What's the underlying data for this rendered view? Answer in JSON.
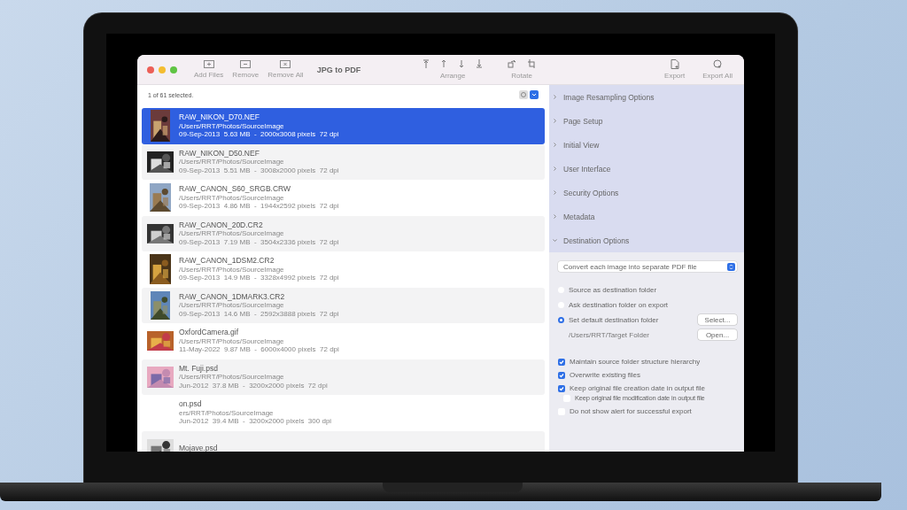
{
  "window": {
    "title": "JPG to PDF"
  },
  "toolbar": {
    "file_buttons": [
      {
        "kind": "add",
        "label": "Add Files"
      },
      {
        "kind": "remove",
        "label": "Remove"
      },
      {
        "kind": "remove_all",
        "label": "Remove All"
      }
    ],
    "arrange": {
      "label": "Arrange",
      "buttons": [
        {
          "kind": "top"
        },
        {
          "kind": "up"
        },
        {
          "kind": "down"
        },
        {
          "kind": "bottom"
        }
      ]
    },
    "rotate": {
      "label": "Rotate",
      "buttons": [
        {
          "kind": "left"
        },
        {
          "kind": "right"
        }
      ]
    },
    "export_buttons": [
      {
        "kind": "export",
        "label": "Export"
      },
      {
        "kind": "export_all",
        "label": "Export All"
      }
    ]
  },
  "status": "1 of 61 selected.",
  "files": [
    {
      "name": "RAW_NIKON_D70.NEF",
      "path": "/Users/RRT/Photos/SourceImage",
      "meta": "09-Sep-2013  5.63 MB  -  2000x3008 pixels  72 dpi",
      "selected": true
    },
    {
      "name": "RAW_NIKON_D50.NEF",
      "path": "/Users/RRT/Photos/SourceImage",
      "meta": "09-Sep-2013  5.51 MB  -  3008x2000 pixels  72 dpi",
      "selected": false
    },
    {
      "name": "RAW_CANON_S60_SRGB.CRW",
      "path": "/Users/RRT/Photos/SourceImage",
      "meta": "09-Sep-2013  4.86 MB  -  1944x2592 pixels  72 dpi",
      "selected": false
    },
    {
      "name": "RAW_CANON_20D.CR2",
      "path": "/Users/RRT/Photos/SourceImage",
      "meta": "09-Sep-2013  7.19 MB  -  3504x2336 pixels  72 dpi",
      "selected": false
    },
    {
      "name": "RAW_CANON_1DSM2.CR2",
      "path": "/Users/RRT/Photos/SourceImage",
      "meta": "09-Sep-2013  14.9 MB  -  3328x4992 pixels  72 dpi",
      "selected": false
    },
    {
      "name": "RAW_CANON_1DMARK3.CR2",
      "path": "/Users/RRT/Photos/SourceImage",
      "meta": "09-Sep-2013  14.6 MB  -  2592x3888 pixels  72 dpi",
      "selected": false
    },
    {
      "name": "OxfordCamera.gif",
      "path": "/Users/RRT/Photos/SourceImage",
      "meta": "11-May-2022  9.87 MB  -  6000x4000 pixels  72 dpi",
      "selected": false
    },
    {
      "name": "Mt. Fuji.psd",
      "path": "/Users/RRT/Photos/SourceImage",
      "meta": "Jun-2012  37.8 MB  -  3200x2000 pixels  72 dpi",
      "selected": false
    },
    {
      "name": "on.psd",
      "path": "ers/RRT/Photos/SourceImage",
      "meta": "Jun-2012  39.4 MB  -  3200x2000 pixels  300 dpi",
      "selected": false
    },
    {
      "name": "Mojave.psd",
      "selected": false
    }
  ],
  "sections": [
    {
      "label": "Image Resampling Options",
      "expanded": false
    },
    {
      "label": "Page Setup",
      "expanded": false
    },
    {
      "label": "Initial View",
      "expanded": false
    },
    {
      "label": "User Interface",
      "expanded": false
    },
    {
      "label": "Security Options",
      "expanded": false
    },
    {
      "label": "Metadata",
      "expanded": false
    },
    {
      "label": "Destination Options",
      "expanded": true
    }
  ],
  "destination": {
    "mode": "Convert each image into separate PDF file",
    "folder_options": [
      {
        "label": "Source as destination folder",
        "selected": false
      },
      {
        "label": "Ask destination folder on export",
        "selected": false
      },
      {
        "label": "Set default destination folder",
        "selected": true
      }
    ],
    "folder_path": "/Users/RRT/Target Folder",
    "buttons": [
      "Select...",
      "Open..."
    ],
    "checks": [
      {
        "kind": "main",
        "label": "Maintain source folder structure hierarchy",
        "checked": true
      },
      {
        "kind": "main",
        "label": "Overwrite existing files",
        "checked": true
      },
      {
        "kind": "main",
        "label": "Keep original file creation date in output file",
        "checked": true
      },
      {
        "kind": "sub",
        "label": "Keep original file modification date in output file",
        "checked": false
      },
      {
        "kind": "main",
        "label": "Do not show alert for successful export",
        "checked": false
      }
    ]
  }
}
